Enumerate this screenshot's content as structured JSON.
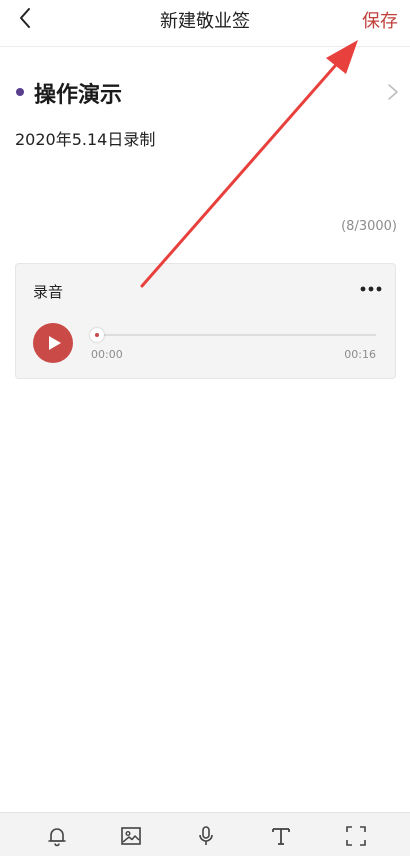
{
  "header": {
    "title": "新建敬业签",
    "save_label": "保存",
    "back_icon": "chevron-left-icon"
  },
  "note": {
    "title": "操作演示",
    "body": "2020年5.14日录制",
    "char_count": "(8/3000)",
    "bullet_color": "#5b3f8f"
  },
  "audio": {
    "label": "录音",
    "current_time": "00:00",
    "duration": "00:16",
    "progress": 0,
    "play_color": "#c94a47"
  },
  "toolbar": {
    "items": [
      "bell-icon",
      "image-icon",
      "microphone-icon",
      "text-icon",
      "fullscreen-icon"
    ]
  },
  "colors": {
    "accent": "#c0403c",
    "annotation_arrow": "#e8403c"
  }
}
